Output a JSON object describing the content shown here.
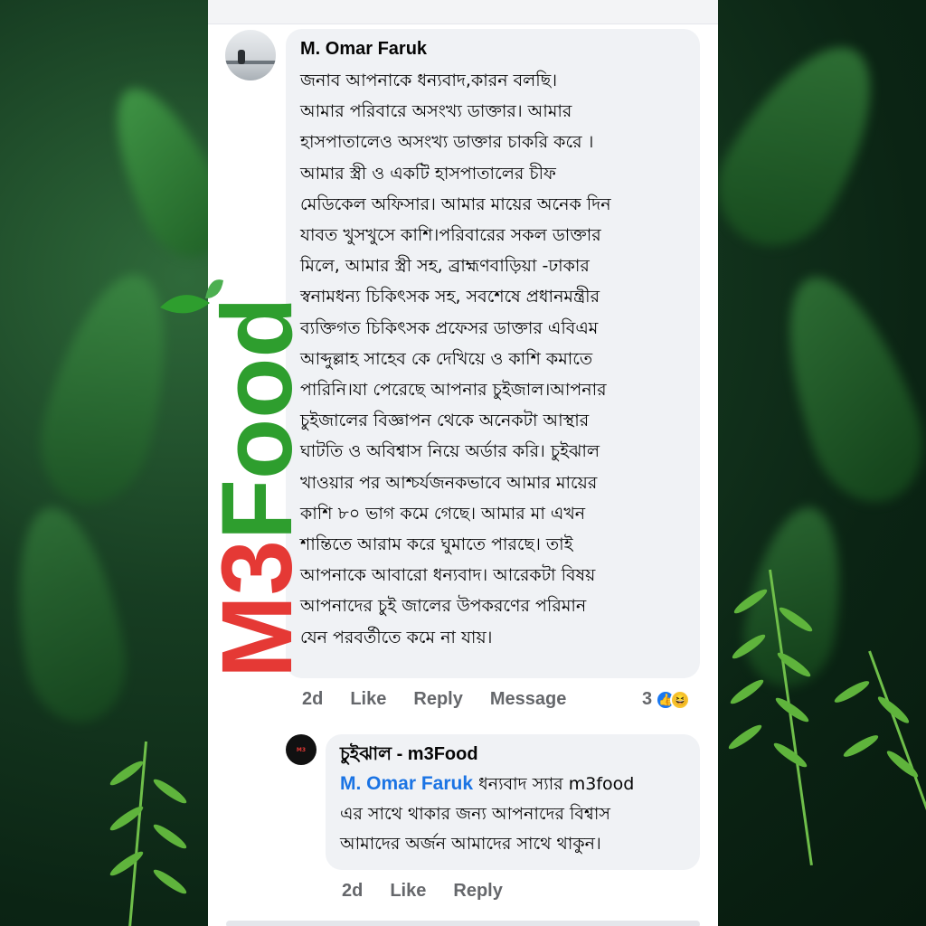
{
  "comment": {
    "author": "M. Omar Faruk",
    "text_lines": [
      "জনাব আপনাকে  ধন্যবাদ,কারন বলছি।",
      "আমার পরিবারে  অসংখ্য ডাক্তার। আমার",
      "হাসপাতালেও  অসংখ্য ডাক্তার চাকরি করে ।",
      "আমার  স্ত্রী ও  একটি হাসপাতালের চীফ",
      "মেডিকেল অফিসার। আমার মায়ের অনেক দিন",
      "যাবত খুসখুসে কাশি।পরিবারের সকল  ডাক্তার",
      "মিলে, আমার স্ত্রী সহ, ব্রাহ্মণবাড়িয়া -ঢাকার",
      "স্বনামধন্য চিকিৎসক সহ, সবশেষে  প্রধানমন্ত্রীর",
      "ব্যক্তিগত চিকিৎসক প্রফেসর ডাক্তার এবিএম",
      "আব্দুল্লাহ সাহেব কে দেখিয়ে ও কাশি কমাতে",
      "পারিনি।যা পেরেছে আপনার চুইজাল।আপনার",
      "চুইজালের বিজ্ঞাপন থেকে অনেকটা আস্থার",
      "ঘাটতি ও অবিশ্বাস  নিয়ে অর্ডার করি। চুইঝাল",
      "খাওয়ার পর আশ্চর্যজনকভাবে আমার মায়ের",
      "কাশি ৮০ ভাগ কমে গেছে। আমার মা এখন",
      "শান্তিতে আরাম করে ঘুমাতে পারছে। তাই",
      "আপনাকে আবারো ধন্যবাদ। আরেকটা বিষয়",
      "আপনাদের চুই জালের উপকরণের পরিমান",
      "যেন পরবর্তীতে কমে না যায়।"
    ],
    "time": "2d",
    "like_label": "Like",
    "reply_label": "Reply",
    "message_label": "Message",
    "reaction_count": "3",
    "reaction_icons": [
      "like-icon",
      "haha-icon"
    ]
  },
  "reply": {
    "author": "চুইঝাল - m3Food",
    "mention": "M. Omar Faruk",
    "text_first": " ধন্যবাদ স্যার m3food",
    "text_lines": [
      "এর সাথে থাকার জন্য আপনাদের বিশ্বাস",
      "আমাদের অর্জন আমাদের সাথে থাকুন।"
    ],
    "time": "2d",
    "like_label": "Like",
    "reply_label": "Reply"
  },
  "watermark": {
    "m": "M",
    "three": "3",
    "food": "Food"
  },
  "colors": {
    "panel": "#ffffff",
    "bubble": "#f0f2f5",
    "meta": "#65676b",
    "mention": "#1b74e4",
    "logo_red": "#e53935",
    "logo_green": "#2e9e2e"
  }
}
